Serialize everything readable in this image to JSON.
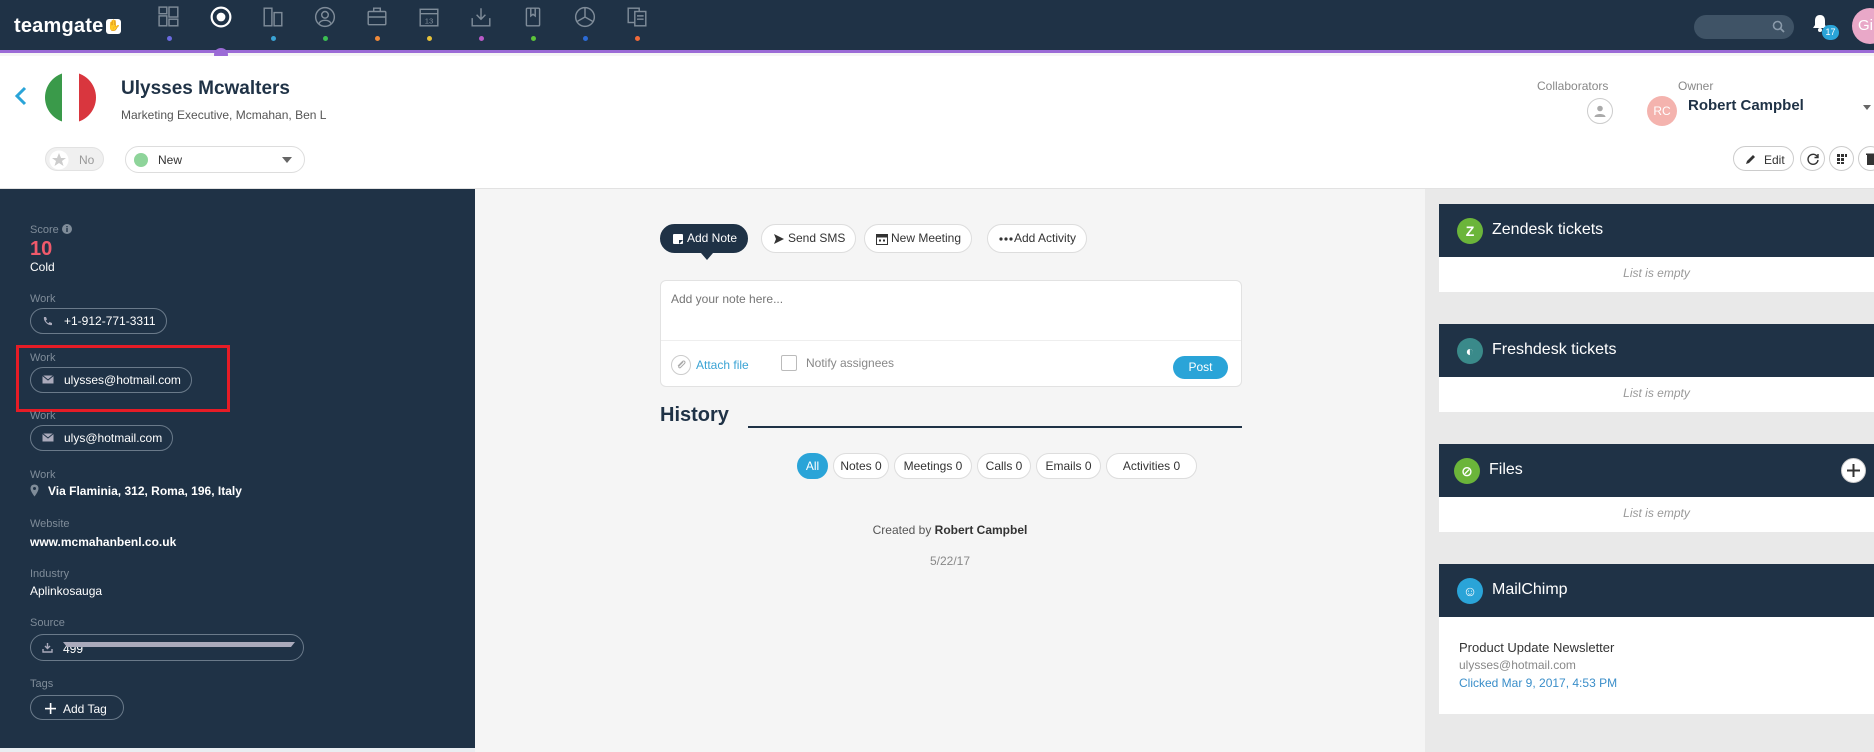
{
  "app": {
    "logo": "teamgate"
  },
  "topbar": {
    "nav_icons": [
      "dashboard-icon",
      "pipeline-icon",
      "companies-icon",
      "people-icon",
      "deals-icon",
      "calendar-icon",
      "inbox-icon",
      "clipboard-icon",
      "reports-icon",
      "lists-icon"
    ],
    "nav_dot_colors": [
      "#6a6ae0",
      "#9b6bd6",
      "#3aa3d4",
      "#3bbf52",
      "#f08a3a",
      "#e6c23a",
      "#b95ac8",
      "#5cc43a",
      "#2b6bd6",
      "#f06a3a"
    ],
    "active_index": 1,
    "notification_count": "17",
    "avatar_initials": "Gi"
  },
  "contact": {
    "name": "Ulysses Mcwalters",
    "subtitle": "Marketing Executive, Mcmahan, Ben L",
    "star_label": "No",
    "status": "New",
    "status_color": "#8ed49a"
  },
  "header_right": {
    "collaborators_label": "Collaborators",
    "owner_label": "Owner",
    "owner_initials": "RC",
    "owner_name": "Robert Campbel",
    "edit_label": "Edit"
  },
  "details": {
    "score_label": "Score",
    "score_value": "10",
    "score_text": "Cold",
    "phone_label": "Work",
    "phone": "+1-912-771-3311",
    "email1_label": "Work",
    "email1": "ulysses@hotmail.com",
    "email2_label": "Work",
    "email2": "ulys@hotmail.com",
    "address_label": "Work",
    "address": "Via Flaminia, 312, Roma, 196, Italy",
    "website_label": "Website",
    "website": "www.mcmahanbenl.co.uk",
    "industry_label": "Industry",
    "industry": "Aplinkosauga",
    "source_label": "Source",
    "source": "499",
    "tags_label": "Tags",
    "add_tag": "Add Tag"
  },
  "actions": {
    "add_note": "Add Note",
    "send_sms": "Send SMS",
    "new_meeting": "New Meeting",
    "add_activity": "Add Activity"
  },
  "note": {
    "placeholder": "Add your note here...",
    "attach": "Attach file",
    "notify": "Notify assignees",
    "post": "Post"
  },
  "history": {
    "title": "History",
    "filters": [
      "All",
      "Notes 0",
      "Meetings 0",
      "Calls 0",
      "Emails 0",
      "Activities 0"
    ],
    "created_by_prefix": "Created by",
    "created_by_name": "Robert Campbel",
    "created_date": "5/22/17"
  },
  "widgets": {
    "zendesk": {
      "title": "Zendesk tickets",
      "empty": "List is empty",
      "color": "#6bb53a"
    },
    "freshdesk": {
      "title": "Freshdesk tickets",
      "empty": "List is empty",
      "color": "#3a8a8a"
    },
    "files": {
      "title": "Files",
      "empty": "List is empty",
      "color": "#6bb53a"
    },
    "mailchimp": {
      "title": "MailChimp",
      "color": "#2aa4d8",
      "campaign": "Product Update Newsletter",
      "email": "ulysses@hotmail.com",
      "clicked": "Clicked Mar 9, 2017, 4:53 PM"
    }
  }
}
